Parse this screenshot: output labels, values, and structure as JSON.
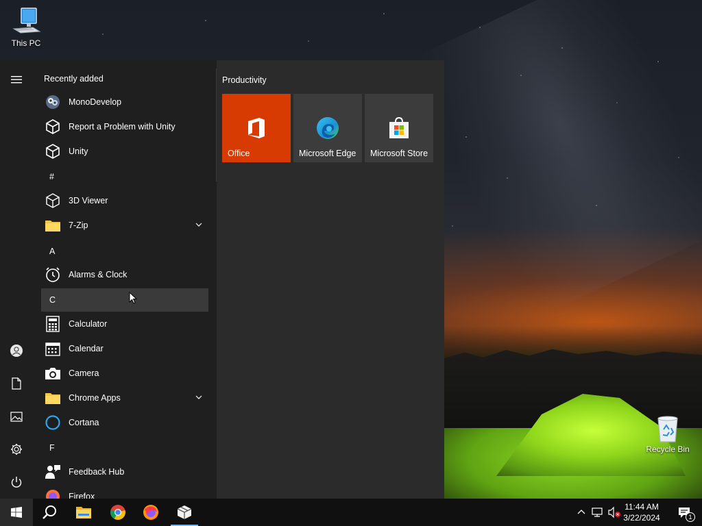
{
  "desktop": {
    "icons": [
      {
        "label": "This PC",
        "icon": "computer-icon"
      },
      {
        "label": "Recycle Bin",
        "icon": "recycle-bin-icon"
      }
    ]
  },
  "start_menu": {
    "rail": [
      {
        "icon": "hamburger-menu-icon"
      },
      {
        "icon": "user-account-icon"
      },
      {
        "icon": "documents-icon"
      },
      {
        "icon": "pictures-icon"
      },
      {
        "icon": "settings-icon"
      },
      {
        "icon": "power-icon"
      }
    ],
    "recently_added_title": "Recently added",
    "recent": [
      {
        "label": "MonoDevelop",
        "icon": "monodevelop-icon"
      },
      {
        "label": "Report a Problem with Unity",
        "icon": "unity-icon"
      },
      {
        "label": "Unity",
        "icon": "unity-icon"
      }
    ],
    "letters": {
      "hash": "#",
      "a": "A",
      "c": "C",
      "f": "F"
    },
    "apps": {
      "viewer_3d": "3D Viewer",
      "zip": "7-Zip",
      "alarms": "Alarms & Clock",
      "calculator": "Calculator",
      "calendar": "Calendar",
      "camera": "Camera",
      "chrome_apps": "Chrome Apps",
      "cortana": "Cortana",
      "feedback_hub": "Feedback Hub",
      "firefox": "Firefox"
    },
    "tiles_group_title": "Productivity",
    "tiles": [
      {
        "label": "Office",
        "color": "#d83b01",
        "icon": "office-icon"
      },
      {
        "label": "Microsoft Edge",
        "color": "#3c3c3c",
        "icon": "edge-icon"
      },
      {
        "label": "Microsoft Store",
        "color": "#3c3c3c",
        "icon": "store-icon"
      }
    ]
  },
  "taskbar": {
    "apps": [
      {
        "icon": "windows-start-icon"
      },
      {
        "icon": "search-icon"
      },
      {
        "icon": "file-explorer-icon"
      },
      {
        "icon": "chrome-icon"
      },
      {
        "icon": "firefox-icon"
      },
      {
        "icon": "package-app-icon"
      }
    ],
    "tray": {
      "time": "11:44 AM",
      "date": "3/22/2024",
      "notification_count": "1"
    }
  },
  "colors": {
    "accent": "#76b9ed",
    "office_tile": "#d83b01",
    "start_bg": "#2b2b2b",
    "list_bg": "#1f1f1f"
  }
}
